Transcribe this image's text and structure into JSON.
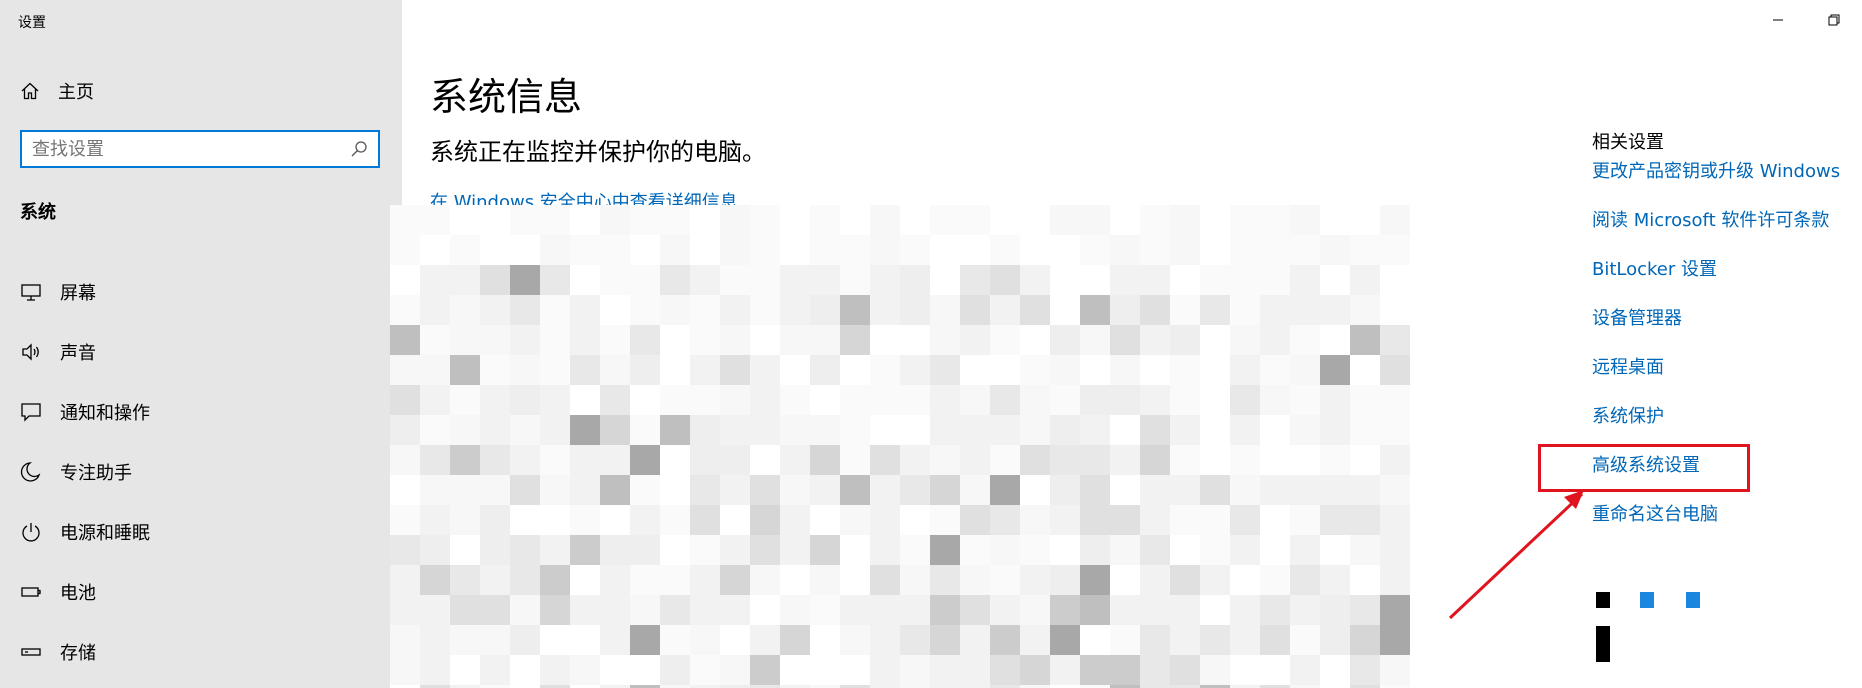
{
  "app": {
    "title": "设置"
  },
  "sidebar": {
    "home_label": "主页",
    "search_placeholder": "查找设置",
    "section_title": "系统",
    "items": [
      {
        "label": "屏幕",
        "icon": "monitor-icon"
      },
      {
        "label": "声音",
        "icon": "speaker-icon"
      },
      {
        "label": "通知和操作",
        "icon": "message-icon"
      },
      {
        "label": "专注助手",
        "icon": "moon-icon"
      },
      {
        "label": "电源和睡眠",
        "icon": "power-icon"
      },
      {
        "label": "电池",
        "icon": "battery-icon"
      },
      {
        "label": "存储",
        "icon": "storage-icon"
      }
    ]
  },
  "main": {
    "title": "系统信息",
    "subtitle": "系统正在监控并保护你的电脑。",
    "security_link": "在 Windows 安全中心中查看详细信息"
  },
  "related": {
    "title": "相关设置",
    "links": [
      "更改产品密钥或升级 Windows",
      "阅读 Microsoft 软件许可条款",
      "BitLocker 设置",
      "设备管理器",
      "远程桌面",
      "系统保护",
      "高级系统设置",
      "重命名这台电脑"
    ],
    "highlighted_link": "高级系统设置"
  },
  "colors": {
    "accent": "#0078d7",
    "link": "#0067b8",
    "annotation": "#e0141e",
    "sidebar_bg": "#e6e6e6"
  }
}
